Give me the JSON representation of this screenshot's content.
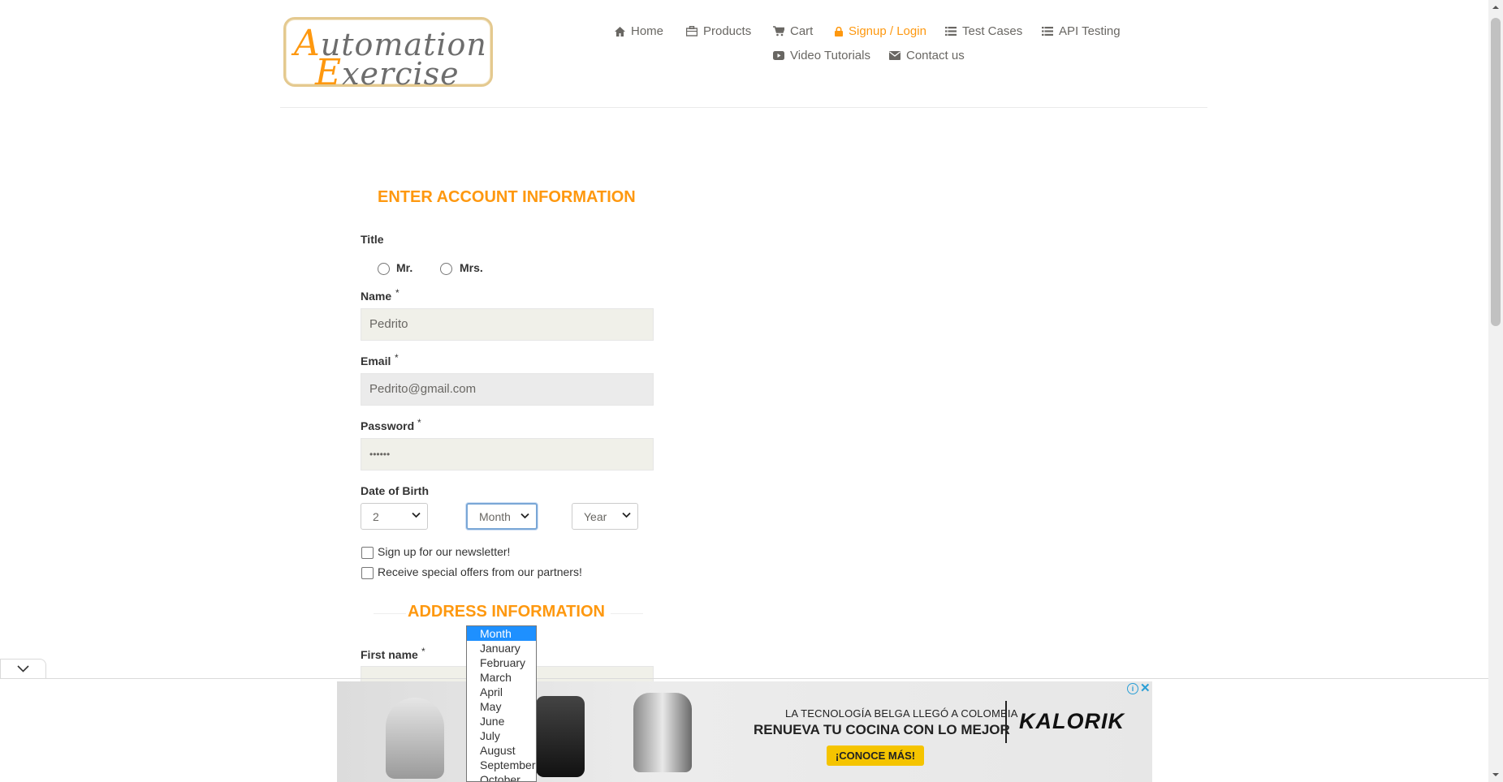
{
  "logo": {
    "line1": "Automation",
    "line2": "Exercise",
    "line1_first": "A",
    "line1_rest": "utomation",
    "line2_first": "E",
    "line2_rest": "xercise"
  },
  "nav": {
    "home": "Home",
    "products": "Products",
    "cart": "Cart",
    "signup_login": "Signup / Login",
    "test_cases": "Test Cases",
    "api_testing": "API Testing",
    "video_tutorials": "Video Tutorials",
    "contact_us": "Contact us"
  },
  "form": {
    "heading": "ENTER ACCOUNT INFORMATION",
    "title_label": "Title",
    "title_options": [
      "Mr.",
      "Mrs."
    ],
    "name_label": "Name",
    "name_value": "Pedrito",
    "email_label": "Email",
    "email_value": "Pedrito@gmail.com",
    "password_label": "Password",
    "password_value": "••••••",
    "required_mark": "*",
    "dob_label": "Date of Birth",
    "day_value": "2",
    "month_value": "Month",
    "year_value": "Year",
    "newsletter_label": "Sign up for our newsletter!",
    "offers_label": "Receive special offers from our partners!",
    "address_heading": "ADDRESS INFORMATION",
    "first_name_label": "First name"
  },
  "month_dropdown": {
    "options": [
      "Month",
      "January",
      "February",
      "March",
      "April",
      "May",
      "June",
      "July",
      "August",
      "September",
      "October"
    ],
    "selected": "Month"
  },
  "ad": {
    "line1": "LA TECNOLOGÍA BELGA LLEGÓ A COLOMBIA",
    "line2": "RENUEVA TU COCINA CON LO MEJOR",
    "brand": "KALORIK",
    "cta": "¡CONOCE MÁS!",
    "info_icon": "i",
    "close_icon": "✕"
  },
  "colors": {
    "accent": "#FE980F",
    "field_bg": "#F0F0E9",
    "text": "#696763"
  }
}
